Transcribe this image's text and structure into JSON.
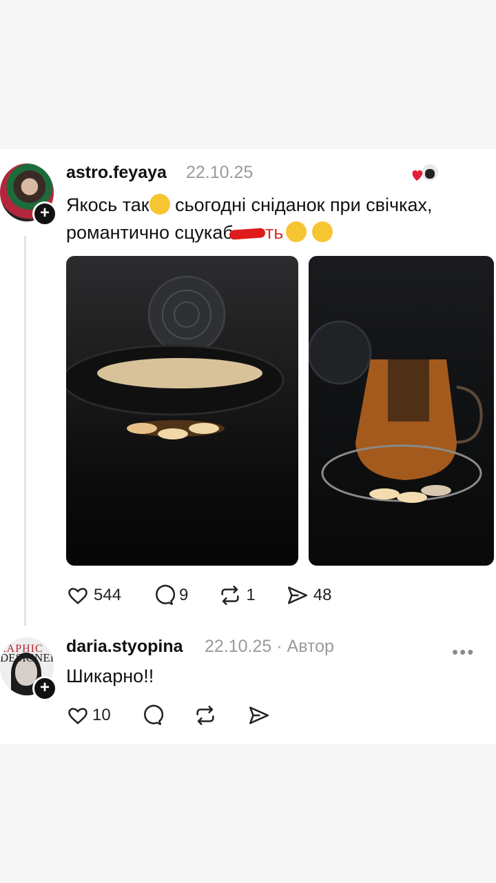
{
  "post": {
    "username": "astro.feyaya",
    "date": "22.10.25",
    "text_line1_a": "Якось так",
    "text_line1_b": " сьогодні сніданок при свічках,",
    "text_line2": "романтично сцукаб",
    "text_line2_tail": "ть",
    "stats": {
      "likes": "544",
      "comments": "9",
      "reposts": "1",
      "shares": "48"
    }
  },
  "reply": {
    "username": "daria.styopina",
    "date": "22.10.25",
    "author_tag": " · Автор",
    "text": "Шикарно!!",
    "stats": {
      "likes": "10"
    }
  },
  "avatar2_text_top": "RAPHIC",
  "avatar2_text_mid": "DESIGNER",
  "more_label": "•••",
  "colors": {
    "accent_heart": "#e0203a",
    "censor": "#e01b1b",
    "muted": "#9a9a9a"
  }
}
